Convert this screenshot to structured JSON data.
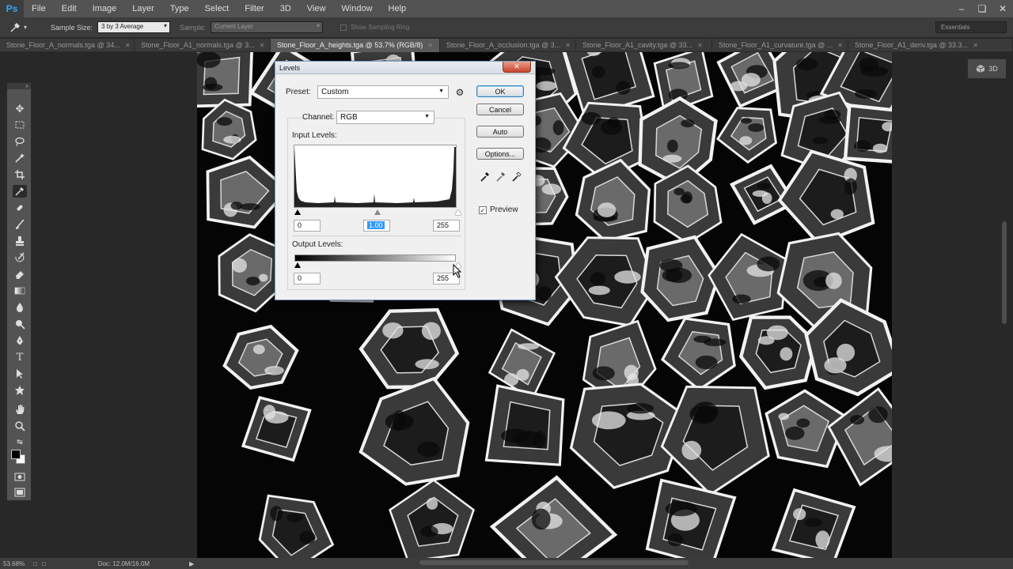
{
  "app": {
    "logo": "Ps",
    "menu": [
      "File",
      "Edit",
      "Image",
      "Layer",
      "Type",
      "Select",
      "Filter",
      "3D",
      "View",
      "Window",
      "Help"
    ],
    "window_controls": [
      "–",
      "❏",
      "✕"
    ]
  },
  "options": {
    "sample_size_label": "Sample Size:",
    "sample_size_value": "3 by 3 Average",
    "sample_label": "Sample:",
    "sample_value": "Current Layer",
    "sampling_ring_label": "Show Sampling Ring",
    "workspace": "Essentials"
  },
  "tabs": [
    {
      "label": "Stone_Floor_A_normals.tga @ 34...",
      "active": false
    },
    {
      "label": "Stone_Floor_A1_normals.tga @ 3...",
      "active": false
    },
    {
      "label": "Stone_Floor_A_heights.tga @ 53.7% (RGB/8)",
      "active": true
    },
    {
      "label": "Stone_Floor_A_occlusion.tga @ 3...",
      "active": false
    },
    {
      "label": "Stone_Floor_A1_cavity.tga @ 33...",
      "active": false
    },
    {
      "label": "Stone_Floor_A1_curvature.tga @ ...",
      "active": false
    },
    {
      "label": "Stone_Floor_A1_deriv.tga @ 33.3...",
      "active": false
    }
  ],
  "panel": {
    "label": "3D"
  },
  "status": {
    "zoom": "53.68%",
    "doc": "Doc: 12.0M/16.0M"
  },
  "levels": {
    "title": "Levels",
    "preset_label": "Preset:",
    "preset_value": "Custom",
    "channel_label": "Channel:",
    "channel_value": "RGB",
    "input_levels_label": "Input Levels:",
    "input_black": "0",
    "input_gamma": "1.00",
    "input_white": "255",
    "output_levels_label": "Output Levels:",
    "output_black": "0",
    "output_white": "255",
    "buttons": {
      "ok": "OK",
      "cancel": "Cancel",
      "auto": "Auto",
      "options": "Options..."
    },
    "preview_label": "Preview",
    "preview_checked": true,
    "close_glyph": "✕"
  },
  "colors": {
    "foreground": "#000000",
    "background": "#ffffff",
    "accent": "#31a8ff"
  }
}
